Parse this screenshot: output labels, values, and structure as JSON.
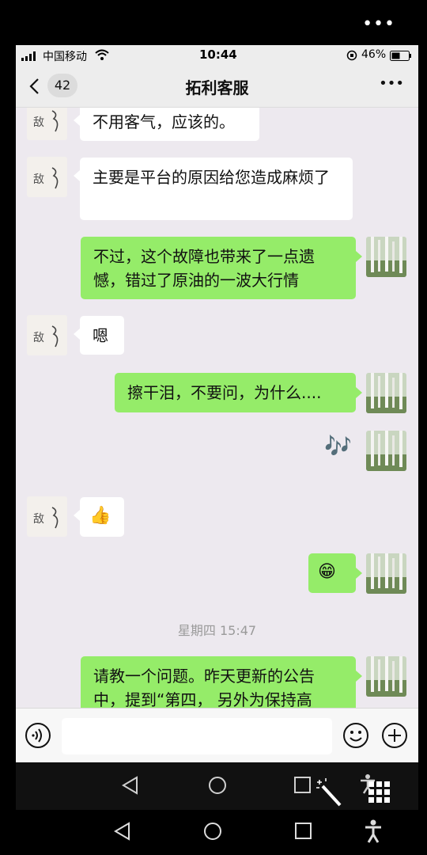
{
  "top_overlay": {
    "more_label": "•••"
  },
  "status_bar": {
    "carrier": "中国移动",
    "time": "10:44",
    "battery": "46%"
  },
  "header": {
    "back_count": "42",
    "title": "拓利客服",
    "more_label": "•••"
  },
  "messages": [
    {
      "side": "left",
      "text": "不用客气，应该的。"
    },
    {
      "side": "left",
      "text": "主要是平台的原因给您造成麻烦了"
    },
    {
      "side": "right",
      "text": "不过，这个故障也带来了一点遗憾，错过了原油的一波大行情"
    },
    {
      "side": "left",
      "text": "嗯"
    },
    {
      "side": "right",
      "text": "擦干泪，不要问，为什么...."
    },
    {
      "side": "right",
      "text": "🎶"
    },
    {
      "side": "left",
      "text": "👍"
    },
    {
      "side": "right",
      "text": "😁"
    },
    {
      "side": "right",
      "text": "请教一个问题。昨天更新的公告中，提到“第四， 另外为保持高"
    }
  ],
  "timestamp": "星期四 15:47",
  "colors": {
    "sent_bubble": "#95ec69",
    "received_bubble": "#ffffff",
    "chat_bg": "#ede9ef"
  },
  "icons": {
    "voice": "voice-icon",
    "emoji": "emoji-icon",
    "plus": "plus-icon",
    "nav_back": "nav-back-icon",
    "nav_home": "nav-home-icon",
    "nav_recent": "nav-recent-icon",
    "accessibility": "accessibility-icon",
    "magic_wand": "magic-wand-icon",
    "keypad": "keypad-icon"
  }
}
